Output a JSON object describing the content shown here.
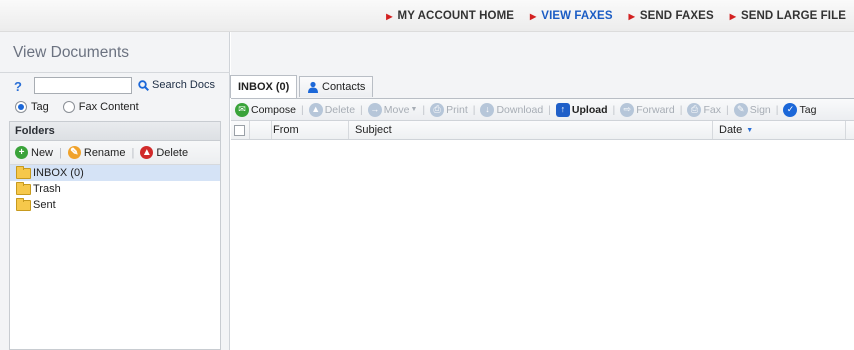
{
  "topnav": {
    "items": [
      {
        "label": "MY ACCOUNT HOME",
        "active": false
      },
      {
        "label": "VIEW FAXES",
        "active": true
      },
      {
        "label": "SEND FAXES",
        "active": false
      },
      {
        "label": "SEND LARGE FILE",
        "active": false
      }
    ]
  },
  "left": {
    "title": "View Documents",
    "help": "?",
    "search": {
      "value": "",
      "button": "Search Docs"
    },
    "radios": [
      {
        "label": "Tag",
        "checked": true
      },
      {
        "label": "Fax Content",
        "checked": false
      }
    ],
    "folders": {
      "header": "Folders",
      "toolbar": {
        "new": "New",
        "rename": "Rename",
        "delete": "Delete"
      },
      "items": [
        {
          "label": "INBOX (0)",
          "selected": true
        },
        {
          "label": "Trash",
          "selected": false
        },
        {
          "label": "Sent",
          "selected": false
        }
      ]
    }
  },
  "main": {
    "tabs": [
      {
        "label": "INBOX (0)",
        "active": true
      },
      {
        "label": "Contacts",
        "active": false
      }
    ],
    "toolbar": {
      "compose": "Compose",
      "delete": "Delete",
      "move": "Move",
      "print": "Print",
      "download": "Download",
      "upload": "Upload",
      "forward": "Forward",
      "fax": "Fax",
      "sign": "Sign",
      "tag": "Tag"
    },
    "columns": {
      "from": "From",
      "subject": "Subject",
      "date": "Date"
    }
  },
  "colors": {
    "accent": "#1a5cc4",
    "arrow": "#d32020",
    "green": "#3aa33a",
    "orange": "#f0a22a",
    "red": "#d12a2a"
  }
}
